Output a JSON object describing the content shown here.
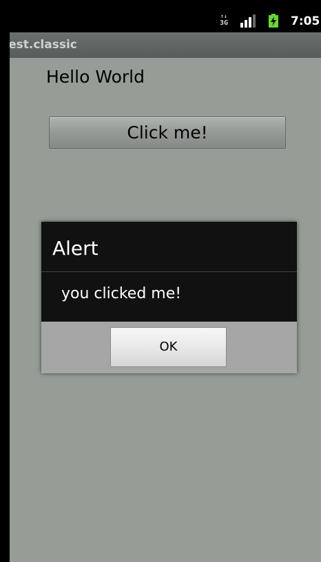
{
  "status_bar": {
    "network_label": "3G",
    "network_arrows": "↑↓",
    "signal_icon": "signal-bars-icon",
    "battery_icon": "battery-charging-icon",
    "time": "7:05",
    "colors": {
      "background": "#000000",
      "battery_green": "#65d632",
      "signal": "#ffffff"
    }
  },
  "app": {
    "title": "test.classic",
    "content_background": "#959d96"
  },
  "main": {
    "hello_text": "Hello World",
    "click_button_label": "Click me!"
  },
  "dialog": {
    "title": "Alert",
    "message": "you clicked me!",
    "ok_label": "OK",
    "colors": {
      "header_background": "#111111",
      "footer_background": "#a6a6a6"
    }
  }
}
